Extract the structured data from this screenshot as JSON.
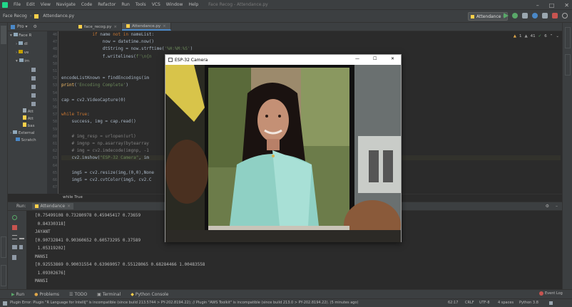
{
  "menubar": {
    "items": [
      "File",
      "Edit",
      "View",
      "Navigate",
      "Code",
      "Refactor",
      "Run",
      "Tools",
      "VCS",
      "Window",
      "Help"
    ],
    "title": "Face Recog - Attendance.py"
  },
  "toolbar": {
    "project": "Face Recog",
    "file": "Attendance.py",
    "run_config": "Attendance"
  },
  "project_panel": {
    "header": "Pro",
    "items": [
      "Face R",
      "dl",
      "ve",
      "im",
      "Att",
      "Att",
      "bas",
      "External",
      "Scratch"
    ]
  },
  "tabs": [
    "face_recog.py",
    "Attendance.py"
  ],
  "inspect": {
    "warn": "1",
    "weak": "41",
    "ok": "6"
  },
  "editor": {
    "line_numbers": [
      "46",
      "47",
      "48",
      "49",
      "50",
      "51",
      "52",
      "53",
      "54",
      "55",
      "56",
      "57",
      "58",
      "59",
      "60",
      "61",
      "62",
      "63",
      "64",
      "65",
      "66",
      "67"
    ],
    "lines": [
      {
        "n": "46",
        "indent": "            ",
        "parts": [
          [
            "kw",
            "if "
          ],
          [
            "",
            "name "
          ],
          [
            "kw",
            "not in "
          ],
          [
            "",
            "nameList:"
          ]
        ]
      },
      {
        "n": "47",
        "indent": "                ",
        "parts": [
          [
            "",
            "now = datetime.now()"
          ]
        ]
      },
      {
        "n": "48",
        "indent": "                ",
        "parts": [
          [
            "",
            "dtString = now.strftime("
          ],
          [
            "str",
            "'%H:%M:%S'"
          ],
          [
            "",
            ")"
          ]
        ]
      },
      {
        "n": "49",
        "indent": "                ",
        "parts": [
          [
            "",
            "f.writelines("
          ],
          [
            "str",
            "f'\\n{n"
          ]
        ]
      },
      {
        "n": "52",
        "indent": "",
        "parts": [
          [
            "",
            "encodeListKnown = findEncodings(im"
          ]
        ]
      },
      {
        "n": "53",
        "indent": "",
        "parts": [
          [
            "fn",
            "print"
          ],
          [
            "",
            "("
          ],
          [
            "str",
            "'Encoding Complete'"
          ],
          [
            "",
            ")"
          ]
        ]
      },
      {
        "n": "55",
        "indent": "",
        "parts": [
          [
            "",
            "cap = cv2.VideoCapture(0)"
          ]
        ]
      },
      {
        "n": "57",
        "indent": "",
        "parts": [
          [
            "kw",
            "while True"
          ],
          [
            "",
            ":"
          ]
        ]
      },
      {
        "n": "58",
        "indent": "    ",
        "parts": [
          [
            "",
            "success, img = cap.read()"
          ]
        ]
      },
      {
        "n": "60",
        "indent": "    ",
        "parts": [
          [
            "cm",
            "# img_resp = urlopen(url)"
          ]
        ]
      },
      {
        "n": "61",
        "indent": "    ",
        "parts": [
          [
            "cm",
            "# imgnp = np.asarray(bytearray"
          ]
        ]
      },
      {
        "n": "62",
        "indent": "    ",
        "parts": [
          [
            "cm",
            "# img = cv2.imdecode(imgnp, -1"
          ]
        ]
      },
      {
        "n": "63",
        "indent": "    ",
        "parts": [
          [
            "",
            "cv2.imshow("
          ],
          [
            "str",
            "\"ESP-32 Camera\""
          ],
          [
            "",
            ", im"
          ]
        ]
      },
      {
        "n": "65",
        "indent": "    ",
        "parts": [
          [
            "",
            "imgS = cv2.resize(img,(0,0),None"
          ]
        ]
      },
      {
        "n": "66",
        "indent": "    ",
        "parts": [
          [
            "",
            "imgS = cv2.cvtColor(imgS, cv2.C"
          ]
        ]
      }
    ],
    "breadcrumb": "while True"
  },
  "run": {
    "label": "Run:",
    "config": "Attendance",
    "output": [
      "[0.75499108 0.73280978 0.45945417 0.73659",
      " 0.84330318]",
      "JAYANT",
      "[0.90732841 0.90360652 0.60573295 0.37589",
      " 1.05319202]",
      "MANSI",
      "[0.92553869 0.90031554 0.63969057 0.55128065 0.68284466 1.00483558",
      " 1.09302676]",
      "MANSI"
    ]
  },
  "toolwindows": [
    "Run",
    "Problems",
    "TODO",
    "Terminal",
    "Python Console"
  ],
  "status": {
    "message": "Plugin Error: Plugin \"R Language for IntelliJ\" is incompatible (since build 213.5744 > PY-202.8194.22); // Plugin \"AWS Toolkit\" is incompatible (since build 213.0 > PY-202.8194.22). (5 minutes ago)",
    "position": "62:17",
    "line_sep": "CRLF",
    "encoding": "UTF-8",
    "indent": "4 spaces",
    "interpreter": "Python 3.8",
    "event_log": "Event Log"
  },
  "camera": {
    "title": "ESP-32 Camera",
    "min": "—",
    "max": "☐",
    "close": "✕"
  },
  "colors": {
    "accent": "#4a88c7",
    "keyword": "#cc7832",
    "string": "#6a8759",
    "comment": "#808080"
  }
}
